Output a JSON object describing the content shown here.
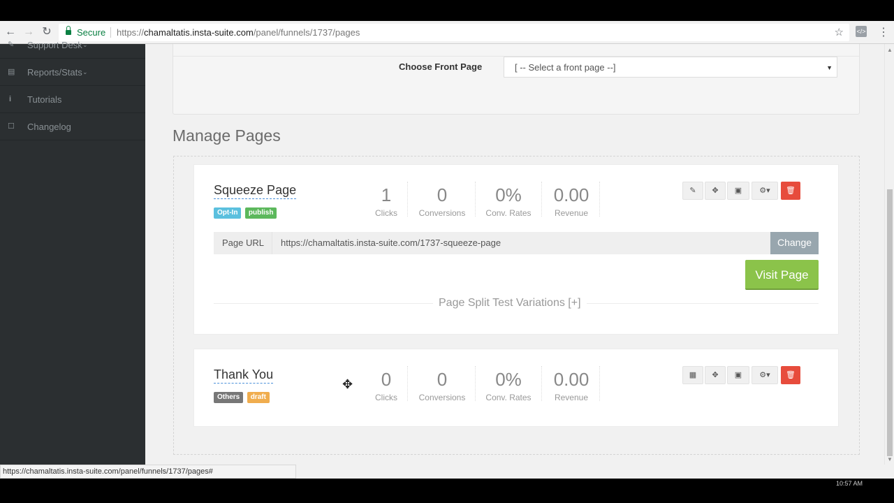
{
  "browser": {
    "secure_label": "Secure",
    "url_prefix": "https://",
    "url_domain": "chamaltatis.insta-suite.com",
    "url_path": "/panel/funnels/1737/pages"
  },
  "sidebar": {
    "items": [
      {
        "label": "Support Desk",
        "icon": "tag-icon"
      },
      {
        "label": "Reports/Stats",
        "icon": "report-icon"
      },
      {
        "label": "Tutorials",
        "icon": "info-icon"
      },
      {
        "label": "Changelog",
        "icon": "document-icon"
      }
    ]
  },
  "front_page": {
    "label": "Choose Front Page",
    "selected": "[ -- Select a front page --]"
  },
  "manage": {
    "title": "Manage Pages",
    "stat_captions": [
      "Clicks",
      "Conversions",
      "Conv. Rates",
      "Revenue"
    ],
    "pages": [
      {
        "name": "Squeeze Page",
        "badges": [
          "Opt-In",
          "publish"
        ],
        "stats": [
          "1",
          "0",
          "0%",
          "0.00"
        ],
        "url_label": "Page URL",
        "url": "https://chamaltatis.insta-suite.com/1737-squeeze-page",
        "change_label": "Change",
        "visit_label": "Visit Page",
        "split_label": "Page Split Test Variations [+]"
      },
      {
        "name": "Thank You",
        "badges": [
          "Others",
          "draft"
        ],
        "stats": [
          "0",
          "0",
          "0%",
          "0.00"
        ]
      }
    ]
  },
  "status": {
    "link": "https://chamaltatis.insta-suite.com/panel/funnels/1737/pages#"
  },
  "taskbar": {
    "clock": "10:57 AM"
  },
  "colors": {
    "optin": "#5bc0de",
    "publish": "#5cb85c",
    "others": "#777777",
    "draft": "#f0ad4e",
    "delete": "#e74c3c",
    "visit": "#8bc34a"
  }
}
